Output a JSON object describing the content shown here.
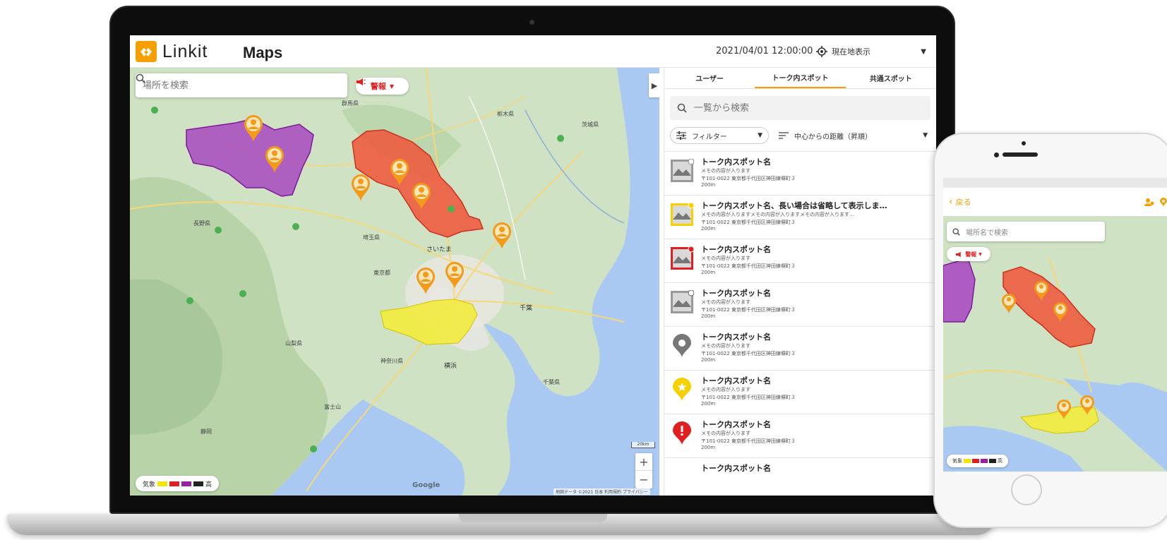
{
  "app": {
    "logo_text": "Linkit",
    "logo_suffix": "Maps",
    "datetime": "2021/04/01 12:00:00",
    "locate_label": "現在地表示"
  },
  "map": {
    "search_placeholder": "場所を検索",
    "alert_label": "警報",
    "legend_low": "気象",
    "legend_high": "高",
    "legend_colors": [
      "#f5e600",
      "#e02020",
      "#9a1fa0",
      "#222222"
    ],
    "scale": "20km",
    "attribution": "地図データ ©2021   日本   利用規約   プライバシー",
    "google": "Google"
  },
  "panel": {
    "tabs": [
      {
        "label": "ユーザー",
        "active": false
      },
      {
        "label": "トーク内スポット",
        "active": true
      },
      {
        "label": "共通スポット",
        "active": false
      }
    ],
    "list_search_placeholder": "一覧から検索",
    "filter_label": "フィルター",
    "sort_label": "中心からの距離（昇順）",
    "items": [
      {
        "title": "トーク内スポット名",
        "memo": "メモの内容が入ります",
        "address": "〒101-0022 東京都千代田区神田練塀町３",
        "distance": "200m",
        "thumb": "photo-gray"
      },
      {
        "title": "トーク内スポット名、長い場合は省略して表示しま…",
        "memo": "メモの内容が入りますメモの内容が入りますメモの内容が入ります…",
        "address": "〒101-0022 東京都千代田区神田練塀町３",
        "distance": "200m",
        "thumb": "photo-yellow"
      },
      {
        "title": "トーク内スポット名",
        "memo": "メモの内容が入ります",
        "address": "〒101-0022 東京都千代田区神田練塀町３",
        "distance": "200m",
        "thumb": "photo-red"
      },
      {
        "title": "トーク内スポット名",
        "memo": "メモの内容が入ります",
        "address": "〒101-0022 東京都千代田区神田練塀町３",
        "distance": "200m",
        "thumb": "photo-gray-alt"
      },
      {
        "title": "トーク内スポット名",
        "memo": "メモの内容が入ります",
        "address": "〒101-0022 東京都千代田区神田練塀町３",
        "distance": "200m",
        "thumb": "pin-gray"
      },
      {
        "title": "トーク内スポット名",
        "memo": "メモの内容が入ります",
        "address": "〒101-0022 東京都千代田区神田練塀町３",
        "distance": "200m",
        "thumb": "pin-yellow-star"
      },
      {
        "title": "トーク内スポット名",
        "memo": "メモの内容が入ります",
        "address": "〒101-0022 東京都千代田区神田練塀町３",
        "distance": "200m",
        "thumb": "pin-red-alert"
      },
      {
        "title": "トーク内スポット名",
        "memo": "",
        "address": "",
        "distance": "",
        "thumb": "none"
      }
    ]
  },
  "map_labels": [
    "群馬県",
    "栃木県",
    "茨城県",
    "長野県",
    "埼玉県",
    "さいたま",
    "東京都",
    "千葉",
    "神奈川県",
    "山梨県",
    "静岡",
    "横浜",
    "千葉県",
    "富士山"
  ],
  "phone": {
    "back_label": "戻る",
    "search_placeholder": "場所名で検索",
    "alert_label": "警報",
    "legend_low": "気象",
    "legend_high": "高"
  },
  "colors": {
    "accent": "#f5a000",
    "alert_red": "#e02020",
    "region_purple": "#a43bc0",
    "region_red": "#f0553a",
    "region_yellow": "#f3ec3a",
    "map_land": "#cfe2c4",
    "map_water": "#a9c9f2"
  }
}
